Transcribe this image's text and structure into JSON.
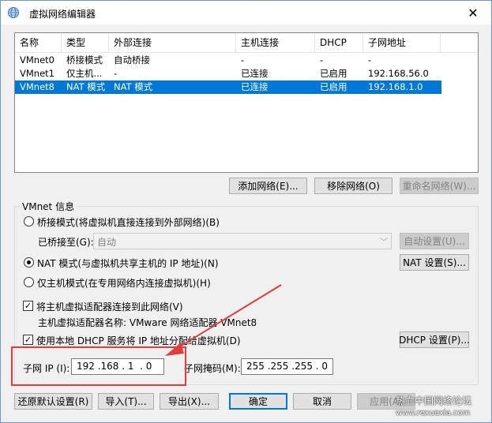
{
  "window": {
    "title": "虚拟网络编辑器",
    "close_glyph": "✕"
  },
  "list": {
    "headers": [
      "名称",
      "类型",
      "外部连接",
      "主机连接",
      "DHCP",
      "子网地址"
    ],
    "rows": [
      [
        "VMnet0",
        "桥接模式",
        "自动桥接",
        "-",
        "-",
        "-"
      ],
      [
        "VMnet1",
        "仅主机...",
        "-",
        "已连接",
        "已启用",
        "192.168.56.0"
      ],
      [
        "VMnet8",
        "NAT 模式",
        "NAT 模式",
        "已连接",
        "已启用",
        "192.168.1.0"
      ]
    ],
    "selected_row": 2
  },
  "list_buttons": {
    "add": "添加网络(E)...",
    "remove": "移除网络(O)",
    "rename": "重命名网络(W)..."
  },
  "vmnet_info": {
    "title": "VMnet 信息",
    "bridged_radio": "桥接模式(将虚拟机直接连接到外部网络)(B)",
    "bridged_to_label": "已桥接至(G):",
    "bridged_to_value": "自动",
    "auto_settings": "自动设置(U)...",
    "nat_radio": "NAT 模式(与虚拟机共享主机的 IP 地址)(N)",
    "nat_settings": "NAT 设置(S)...",
    "hostonly_radio": "仅主机模式(在专用网络内连接虚拟机)(H)",
    "selected_mode": "nat",
    "connect_adapter_check": "将主机虚拟适配器连接到此网络(V)",
    "adapter_name": "主机虚拟适配器名称: VMware 网络适配器 VMnet8",
    "dhcp_check": "使用本地 DHCP 服务将 IP 地址分配给虚拟机(D)",
    "dhcp_settings": "DHCP 设置(P)...",
    "subnet_ip_label": "子网 IP (I):",
    "subnet_ip": "192 .168 . 1  . 0",
    "subnet_mask_label": "子网掩码(M):",
    "subnet_mask": "255 .255 .255 . 0"
  },
  "footer": {
    "restore": "还原默认设置(R)",
    "import": "导入(T)...",
    "export": "导出(X)...",
    "ok": "确定",
    "cancel": "取消",
    "apply": "应用(A)"
  },
  "watermark": {
    "line1": "热血中国网络论坛",
    "line2": "www.rexuexia.com"
  },
  "colors": {
    "selection": "#0078d7",
    "annotation": "#e23b3b"
  }
}
